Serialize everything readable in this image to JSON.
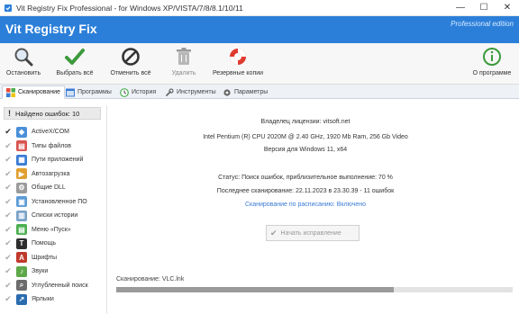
{
  "window": {
    "title": "Vit Registry Fix Professional - for Windows XP/VISTA/7/8/8.1/10/11",
    "buttons": {
      "minimize": "—",
      "maximize": "☐",
      "close": "✕"
    }
  },
  "banner": {
    "app_title": "Vit Registry Fix",
    "edition": "Professional edition"
  },
  "toolbar": {
    "stop": "Остановить",
    "select_all": "Выбрать всё",
    "deselect_all": "Отменить всё",
    "delete": "Удалить",
    "backups": "Резервные копии",
    "about": "О программе"
  },
  "tabs": [
    "Сканирование",
    "Программы",
    "История",
    "Инструменты",
    "Параметры"
  ],
  "sidebar": {
    "found_label": "Найдено ошибок: 10",
    "categories": [
      {
        "label": "ActiveX/COM",
        "icon": "activex-icon",
        "color": "#4a8fd9"
      },
      {
        "label": "Типы файлов",
        "icon": "filetypes-icon",
        "color": "#d9534f"
      },
      {
        "label": "Пути приложений",
        "icon": "apppaths-icon",
        "color": "#3a7bd5"
      },
      {
        "label": "Автозагрузка",
        "icon": "startup-icon",
        "color": "#e0a030"
      },
      {
        "label": "Общие DLL",
        "icon": "shared-dll-icon",
        "color": "#9b9b9b"
      },
      {
        "label": "Установленное ПО",
        "icon": "installed-software-icon",
        "color": "#5b9bd5"
      },
      {
        "label": "Списки истории",
        "icon": "history-lists-icon",
        "color": "#7aa2c8"
      },
      {
        "label": "Меню «Пуск»",
        "icon": "start-menu-icon",
        "color": "#4caf50"
      },
      {
        "label": "Помощь",
        "icon": "help-icon",
        "color": "#2d2d2d"
      },
      {
        "label": "Шрифты",
        "icon": "fonts-icon",
        "color": "#c0392b"
      },
      {
        "label": "Звуки",
        "icon": "sounds-icon",
        "color": "#5fa84a"
      },
      {
        "label": "Углубленный поиск",
        "icon": "deep-search-icon",
        "color": "#6c6c6c"
      },
      {
        "label": "Ярлыки",
        "icon": "shortcuts-icon",
        "color": "#2b6cb0"
      }
    ]
  },
  "main": {
    "license": "Владелец лицензии: vitsoft.net",
    "cpu": "Intel Pentium (R) CPU 2020M @ 2.40 GHz, 1920 Mb Ram, 256 Gb Video",
    "os": "Версия для Windows 11, x64",
    "status": "Статус: Поиск ошибок, приблизительное выполнение: 70 %",
    "last_scan": "Последнее сканирование: 22.11.2023 в 23.30.39 - 11 ошибок",
    "scheduled": "Сканирование по расписанию: Включено",
    "go_button": "Начать исправление",
    "scan_label": "Сканирование: VLC.lnk",
    "progress_percent": 70
  }
}
